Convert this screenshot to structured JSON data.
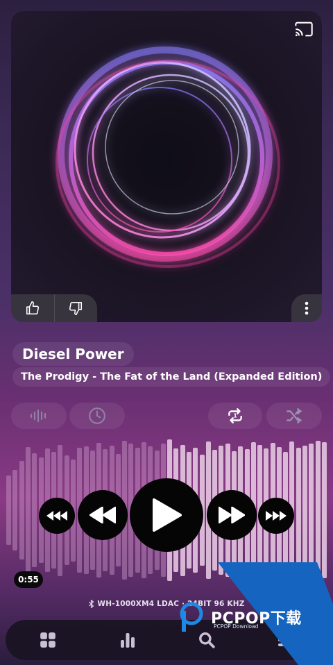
{
  "track": {
    "title": "Diesel Power",
    "subtitle": "The Prodigy - The Fat of the Land (Expanded Edition)"
  },
  "playback": {
    "elapsed": "0:55",
    "progress": 0.5
  },
  "device": {
    "text": "WH-1000XM4  LDAC · 24BIT 96 KHZ"
  },
  "watermark": {
    "brand": "PCPOP下载",
    "sub": "PCPOP Download"
  },
  "icons": {
    "cast": "cast-icon",
    "like": "thumbs-up-icon",
    "dislike": "thumbs-down-icon",
    "more": "more-vertical-icon",
    "visualizer": "waveform-icon",
    "sleep": "clock-icon",
    "repeat": "repeat-icon",
    "shuffle": "shuffle-icon",
    "fast_rewind": "fast-rewind-icon",
    "rewind": "rewind-icon",
    "play": "play-icon",
    "forward": "forward-icon",
    "fast_forward": "fast-forward-icon",
    "nav_library": "grid-icon",
    "nav_stats": "bar-chart-icon",
    "nav_search": "search-icon",
    "nav_menu": "menu-icon"
  },
  "colors": {
    "accent": "#ffffff",
    "played_bars": "#c89ac8",
    "unplayed_bars": "#eacfe6",
    "watermark_blue": "#1565c0"
  }
}
